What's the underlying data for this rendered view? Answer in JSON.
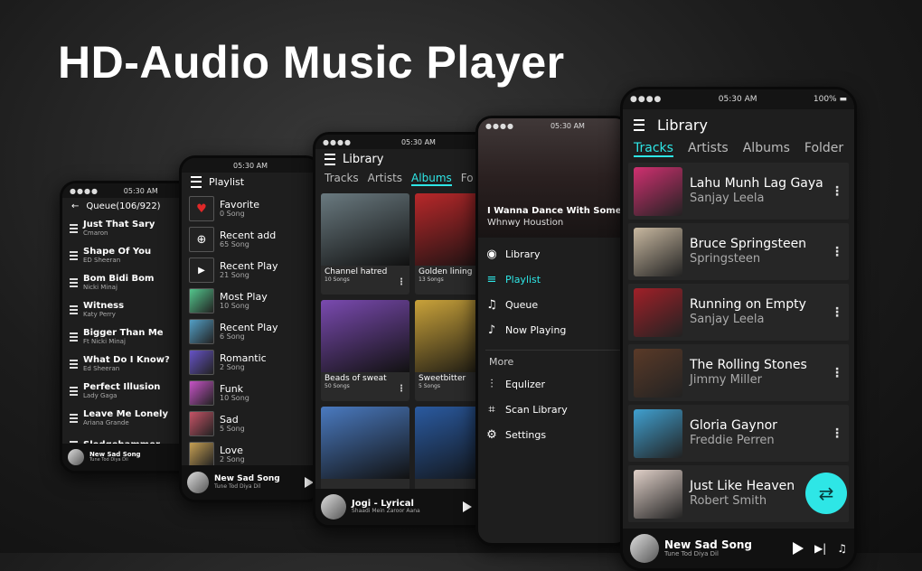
{
  "headline": "HD-Audio Music Player",
  "queue_screen": {
    "time": "05:30 AM",
    "title": "Queue(106/922)",
    "items": [
      {
        "title": "Just That Sary",
        "artist": "Cmaron"
      },
      {
        "title": "Shape Of You",
        "artist": "ED Sheeran"
      },
      {
        "title": "Bom Bidi Bom",
        "artist": "Nicki Minaj"
      },
      {
        "title": "Witness",
        "artist": "Katy Perry"
      },
      {
        "title": "Bigger Than Me",
        "artist": "Ft Nicki Minaj"
      },
      {
        "title": "What Do I Know?",
        "artist": "Ed Sheeran"
      },
      {
        "title": "Perfect Illusion",
        "artist": "Lady Gaga"
      },
      {
        "title": "Leave Me Lonely",
        "artist": "Ariana Grande"
      },
      {
        "title": "Sledgehammer",
        "artist": ""
      }
    ],
    "now_playing": {
      "title": "New Sad Song",
      "subtitle": "Tune Tod Diya Dil"
    }
  },
  "playlist_screen": {
    "time": "05:30 AM",
    "title": "Playlist",
    "items": [
      {
        "name": "Favorite",
        "count": "0 Song"
      },
      {
        "name": "Recent add",
        "count": "65 Song"
      },
      {
        "name": "Recent Play",
        "count": "21 Song"
      },
      {
        "name": "Most Play",
        "count": "10 Song"
      },
      {
        "name": "Recent Play",
        "count": "6 Song"
      },
      {
        "name": "Romantic",
        "count": "2 Song"
      },
      {
        "name": "Funk",
        "count": "10 Song"
      },
      {
        "name": "Sad",
        "count": "5 Song"
      },
      {
        "name": "Love",
        "count": "2 Song"
      }
    ],
    "now_playing": {
      "title": "New Sad Song",
      "subtitle": "Tune Tod Diya Dil"
    }
  },
  "albums_screen": {
    "time": "05:30 AM",
    "title": "Library",
    "tabs": [
      "Tracks",
      "Artists",
      "Albums",
      "Fo"
    ],
    "albums": [
      {
        "name": "Channel hatred",
        "count": "10 Songs",
        "color": "#6a7a80"
      },
      {
        "name": "Golden lining",
        "count": "13 Songs",
        "color": "#b8282a"
      },
      {
        "name": "Beads of sweat",
        "count": "50 Songs",
        "color": "#7a4ab0"
      },
      {
        "name": "Sweetbitter",
        "count": "5 Songs",
        "color": "#c9a23a"
      },
      {
        "name": "",
        "count": "",
        "color": "#4a7ac0"
      },
      {
        "name": "",
        "count": "",
        "color": "#2a5aa0"
      }
    ],
    "now_playing": {
      "title": "Jogi - Lyrical",
      "subtitle": "Shaadi Mein Zaroor Aana"
    }
  },
  "drawer_screen": {
    "time": "05:30 AM",
    "hero_title": "I Wanna Dance With SomeB",
    "hero_artist": "Whnwy Houstion",
    "menu": [
      "Library",
      "Playlist",
      "Queue",
      "Now Playing"
    ],
    "more_label": "More",
    "more_menu": [
      "Equlizer",
      "Scan Library",
      "Settings"
    ]
  },
  "library_screen": {
    "time": "05:30 AM",
    "battery": "100%",
    "title": "Library",
    "tabs": [
      "Tracks",
      "Artists",
      "Albums",
      "Folder"
    ],
    "tracks": [
      {
        "title": "Lahu Munh Lag Gaya",
        "artist": "Sanjay Leela",
        "color": "#d03070"
      },
      {
        "title": "Bruce Springsteen",
        "artist": "Springsteen",
        "color": "#c8b8a0"
      },
      {
        "title": "Running on Empty",
        "artist": "Sanjay Leela",
        "color": "#a02028"
      },
      {
        "title": "The Rolling Stones",
        "artist": "Jimmy Miller",
        "color": "#5a3a28"
      },
      {
        "title": "Gloria Gaynor",
        "artist": "Freddie Perren",
        "color": "#40a0d0"
      },
      {
        "title": "Just Like Heaven",
        "artist": "Robert Smith",
        "color": "#e0d0c8"
      }
    ],
    "now_playing": {
      "title": "New Sad Song",
      "subtitle": "Tune Tod Diya Dil"
    },
    "accent": "#2ee6e6"
  }
}
